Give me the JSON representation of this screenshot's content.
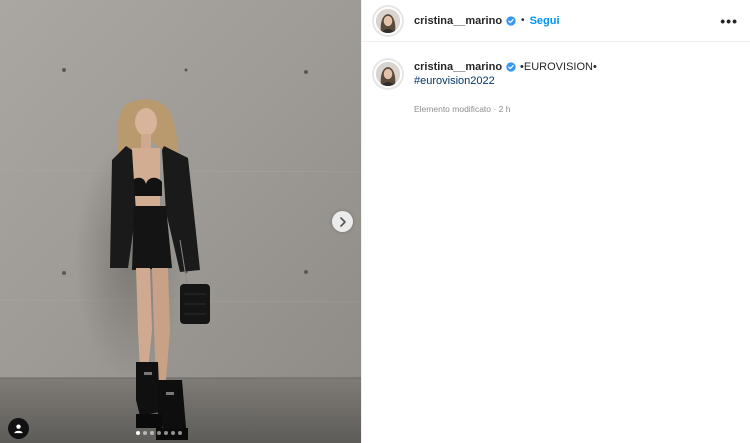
{
  "post": {
    "username": "cristina__marino",
    "follow_label": "Segui",
    "separator": "•",
    "more_label": "•••",
    "caption_text": "•EUROVISION•",
    "hashtag": "#eurovision2022",
    "edited_label": "Elemento modificato",
    "edited_sep": "·",
    "edited_time": "2 h"
  },
  "carousel": {
    "slide_count": 7,
    "active_index": 0
  },
  "colors": {
    "follow": "#0095f6",
    "hashtag": "#00376b",
    "verified": "#3897f0",
    "muted": "#8e8e8e"
  },
  "icons": {
    "verified": "verified-badge-icon",
    "next": "chevron-right-icon",
    "tag": "user-tag-icon"
  }
}
